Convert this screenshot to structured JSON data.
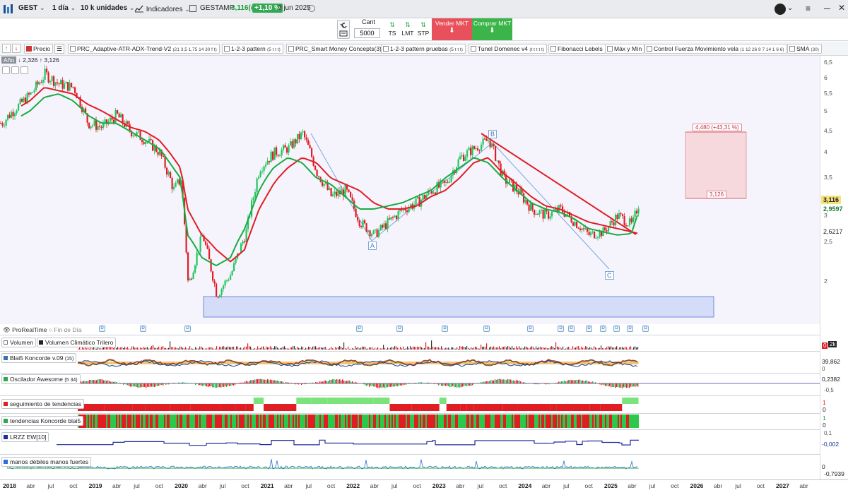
{
  "toolbar": {
    "ticker": "GEST",
    "interval": "1 día",
    "units": "10 k unidades",
    "indicators_label": "Indicadores",
    "instrument": "GESTAMP",
    "last_price": "3,116(c)",
    "change_pct": "+1,10 %",
    "date": "9 jun 2025"
  },
  "orders": {
    "qty_label": "Cant",
    "qty_value": "5000",
    "ts_label": "TS",
    "lmt_label": "LMT",
    "stp_label": "STP",
    "sell_label": "Vender MKT",
    "buy_label": "Comprar MKT"
  },
  "indicators_bar": {
    "price_label": "Precio",
    "chips": [
      {
        "name": "PRC_Adaptive-ATR-ADX-Trend-V2",
        "params": "(21 3,5 1,75 14 30 f t)"
      },
      {
        "name": "1-2-3 pattern",
        "params": "(5 t t t)"
      },
      {
        "name": "PRC_Smart Money Concepts(3)",
        "params": ""
      },
      {
        "name": "1-2-3 pattern pruebas",
        "params": "(5 t t t)"
      },
      {
        "name": "Tunel Domenec v4",
        "params": "(t t t t t)"
      },
      {
        "name": "Fibonacci Lebels",
        "params": ""
      },
      {
        "name": "Máx y Mín",
        "params": ""
      },
      {
        "name": "Control Fuerza Movimiento vela",
        "params": "(1 12 26 9 7 14 1 6 6)"
      },
      {
        "name": "SMA",
        "params": "(30)"
      }
    ]
  },
  "range_info": {
    "period": "Año",
    "low": "2,326",
    "high": "3,126"
  },
  "price_axis": {
    "ticks": [
      "6,5",
      "6",
      "5,5",
      "5",
      "4,5",
      "4",
      "3,5",
      "3",
      "2,5",
      "2"
    ],
    "last_box": "3,116",
    "ma1_box": "2,9597",
    "ma2_box": "2,6217"
  },
  "annotations": {
    "target_box": "4,480 (+43,31 %)",
    "entry_box": "3,126",
    "wave_a": "A",
    "wave_b": "B",
    "wave_c": "C"
  },
  "chart_data": {
    "type": "line",
    "title": "",
    "x": [
      "2018-01",
      "2018-05",
      "2018-07",
      "2018-09",
      "2018-11",
      "2019-01",
      "2019-03",
      "2019-05",
      "2019-07",
      "2019-09",
      "2019-11",
      "2020-01",
      "2020-02",
      "2020-03",
      "2020-05",
      "2020-07",
      "2020-09",
      "2020-11",
      "2021-01",
      "2021-03",
      "2021-05",
      "2021-07",
      "2021-09",
      "2021-11",
      "2022-01",
      "2022-03",
      "2022-05",
      "2022-07",
      "2022-09",
      "2022-11",
      "2023-01",
      "2023-03",
      "2023-05",
      "2023-07",
      "2023-09",
      "2023-11",
      "2024-01",
      "2024-03",
      "2024-05",
      "2024-07",
      "2024-09",
      "2024-11",
      "2025-01",
      "2025-03",
      "2025-05",
      "2025-06"
    ],
    "series": [
      {
        "values": [
          4.7,
          5.5,
          6.1,
          5.8,
          5.7,
          4.7,
          4.6,
          4.9,
          4.5,
          4.3,
          4.0,
          3.3,
          3.5,
          1.95,
          2.6,
          1.85,
          2.1,
          2.6,
          3.7,
          4.0,
          4.1,
          4.45,
          3.6,
          3.2,
          3.3,
          2.8,
          2.6,
          2.8,
          3.0,
          3.1,
          3.3,
          3.4,
          3.9,
          4.1,
          4.3,
          3.5,
          3.3,
          3.0,
          2.9,
          3.0,
          2.8,
          2.6,
          2.65,
          2.9,
          2.75,
          3.116
        ]
      },
      {
        "values": [
          4.8,
          5.3,
          5.7,
          5.6,
          5.5,
          5.2,
          5.0,
          4.8,
          4.6,
          4.5,
          4.3,
          3.9,
          3.7,
          3.0,
          2.6,
          2.4,
          2.25,
          2.4,
          3.0,
          3.4,
          3.7,
          3.9,
          3.8,
          3.5,
          3.4,
          3.3,
          3.1,
          3.0,
          3.0,
          3.05,
          3.2,
          3.3,
          3.5,
          3.8,
          3.9,
          3.6,
          3.4,
          3.2,
          3.05,
          3.0,
          2.9,
          2.8,
          2.75,
          2.7,
          2.65,
          2.62
        ]
      },
      {
        "values": [
          4.6,
          5.0,
          5.4,
          5.5,
          5.3,
          4.9,
          4.7,
          4.7,
          4.5,
          4.3,
          4.1,
          3.7,
          3.5,
          2.6,
          2.3,
          2.2,
          2.3,
          2.7,
          3.3,
          3.7,
          3.9,
          3.8,
          3.5,
          3.4,
          3.2,
          3.0,
          3.0,
          3.05,
          3.1,
          3.2,
          3.3,
          3.5,
          3.7,
          3.9,
          3.8,
          3.5,
          3.3,
          3.1,
          3.0,
          2.95,
          2.85,
          2.7,
          2.65,
          2.6,
          2.62,
          2.9597
        ]
      }
    ],
    "ylim": [
      1.8,
      6.6
    ],
    "grid": false
  },
  "footer": {
    "source": "ProRealTime",
    "end_of_day": "Fin de Día"
  },
  "panels": [
    {
      "title": "Volumen",
      "title2": "Volumen Climático Trilero",
      "values": [
        "0",
        "2k"
      ]
    },
    {
      "title": "Blai5 Koncorde v.09",
      "params": "(15)",
      "values": [
        "39,862",
        "0"
      ]
    },
    {
      "title": "Oscilador Awesome",
      "params": "(5 34)",
      "values": [
        "0,2382",
        "-0,5"
      ]
    },
    {
      "title": "seguimiento de tendencias",
      "values": [
        "1",
        "0"
      ]
    },
    {
      "title": "tendencias Koncorde blai5",
      "values": [
        "1",
        "0"
      ]
    },
    {
      "title": "LRZZ EW[10]",
      "values": [
        "0,1",
        "-0,002"
      ]
    },
    {
      "title": "manos débiles  manos fuertes",
      "values": [
        "0",
        "-0,7939"
      ]
    }
  ],
  "x_axis": [
    {
      "label": "2018",
      "bold": true
    },
    {
      "label": "abr",
      "bold": false
    },
    {
      "label": "jul",
      "bold": false
    },
    {
      "label": "oct",
      "bold": false
    },
    {
      "label": "2019",
      "bold": true
    },
    {
      "label": "abr",
      "bold": false
    },
    {
      "label": "jul",
      "bold": false
    },
    {
      "label": "oct",
      "bold": false
    },
    {
      "label": "2020",
      "bold": true
    },
    {
      "label": "abr",
      "bold": false
    },
    {
      "label": "jul",
      "bold": false
    },
    {
      "label": "oct",
      "bold": false
    },
    {
      "label": "2021",
      "bold": true
    },
    {
      "label": "abr",
      "bold": false
    },
    {
      "label": "jul",
      "bold": false
    },
    {
      "label": "oct",
      "bold": false
    },
    {
      "label": "2022",
      "bold": true
    },
    {
      "label": "abr",
      "bold": false
    },
    {
      "label": "jul",
      "bold": false
    },
    {
      "label": "oct",
      "bold": false
    },
    {
      "label": "2023",
      "bold": true
    },
    {
      "label": "abr",
      "bold": false
    },
    {
      "label": "jul",
      "bold": false
    },
    {
      "label": "oct",
      "bold": false
    },
    {
      "label": "2024",
      "bold": true
    },
    {
      "label": "abr",
      "bold": false
    },
    {
      "label": "jul",
      "bold": false
    },
    {
      "label": "oct",
      "bold": false
    },
    {
      "label": "2025",
      "bold": true
    },
    {
      "label": "abr",
      "bold": false
    },
    {
      "label": "jul",
      "bold": false
    },
    {
      "label": "oct",
      "bold": false
    },
    {
      "label": "2026",
      "bold": true
    },
    {
      "label": "abr",
      "bold": false
    },
    {
      "label": "jul",
      "bold": false
    },
    {
      "label": "oct",
      "bold": false
    },
    {
      "label": "2027",
      "bold": true
    },
    {
      "label": "abr",
      "bold": false
    }
  ],
  "colors": {
    "up": "#22c55e",
    "down": "#e11d24",
    "ma_green": "#1aab40",
    "ma_red": "#e11d24",
    "sell": "#e8505b",
    "buy": "#3bb54a"
  }
}
